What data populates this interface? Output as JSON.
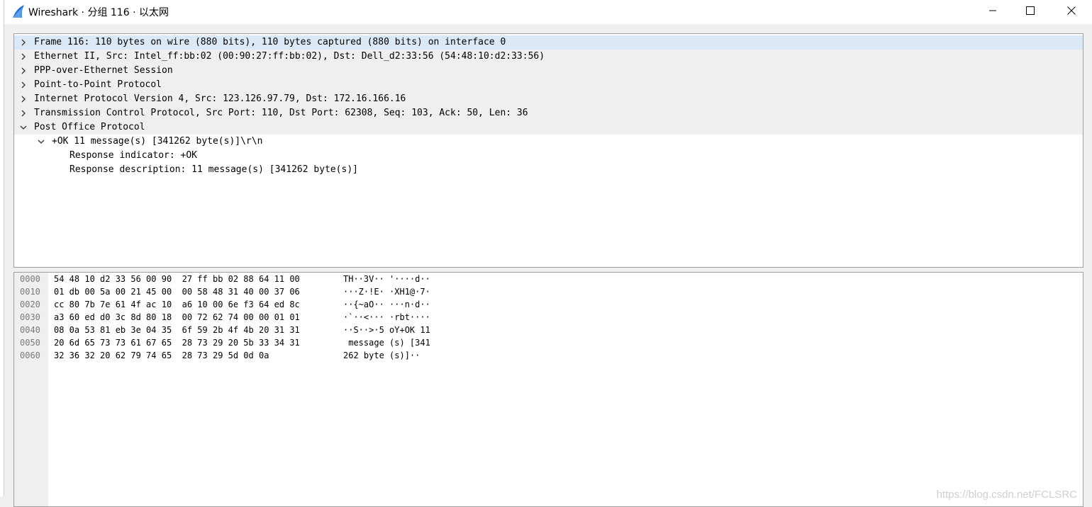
{
  "window": {
    "title": "Wireshark · 分组 116 · 以太网",
    "controls": [
      "minimize-icon",
      "maximize-icon",
      "close-icon"
    ]
  },
  "packet_tree": [
    {
      "label": "Frame 116: 110 bytes on wire (880 bits), 110 bytes captured (880 bits) on interface 0",
      "expanded": false,
      "level": 0,
      "selected": true
    },
    {
      "label": "Ethernet II, Src: Intel_ff:bb:02 (00:90:27:ff:bb:02), Dst: Dell_d2:33:56 (54:48:10:d2:33:56)",
      "expanded": false,
      "level": 0
    },
    {
      "label": "PPP-over-Ethernet Session",
      "expanded": false,
      "level": 0
    },
    {
      "label": "Point-to-Point Protocol",
      "expanded": false,
      "level": 0
    },
    {
      "label": "Internet Protocol Version 4, Src: 123.126.97.79, Dst: 172.16.166.16",
      "expanded": false,
      "level": 0
    },
    {
      "label": "Transmission Control Protocol, Src Port: 110, Dst Port: 62308, Seq: 103, Ack: 50, Len: 36",
      "expanded": false,
      "level": 0
    },
    {
      "label": "Post Office Protocol",
      "expanded": true,
      "level": 0
    },
    {
      "label": "+OK 11 message(s) [341262 byte(s)]\\r\\n",
      "expanded": true,
      "level": 1
    },
    {
      "label": "Response indicator: +OK",
      "level": 2
    },
    {
      "label": "Response description: 11 message(s) [341262 byte(s)]",
      "level": 2
    }
  ],
  "hex_dump": [
    {
      "offset": "0000",
      "bytes": "54 48 10 d2 33 56 00 90  27 ff bb 02 88 64 11 00",
      "ascii": "TH··3V·· '····d··"
    },
    {
      "offset": "0010",
      "bytes": "01 db 00 5a 00 21 45 00  00 58 48 31 40 00 37 06",
      "ascii": "···Z·!E· ·XH1@·7·"
    },
    {
      "offset": "0020",
      "bytes": "cc 80 7b 7e 61 4f ac 10  a6 10 00 6e f3 64 ed 8c",
      "ascii": "··{~aO·· ···n·d··"
    },
    {
      "offset": "0030",
      "bytes": "a3 60 ed d0 3c 8d 80 18  00 72 62 74 00 00 01 01",
      "ascii": "·`··<··· ·rbt····"
    },
    {
      "offset": "0040",
      "bytes": "08 0a 53 81 eb 3e 04 35  6f 59 2b 4f 4b 20 31 31",
      "ascii": "··S··>·5 oY+OK 11"
    },
    {
      "offset": "0050",
      "bytes": "20 6d 65 73 73 61 67 65  28 73 29 20 5b 33 34 31",
      "ascii": " message (s) [341"
    },
    {
      "offset": "0060",
      "bytes": "32 36 32 20 62 79 74 65  28 73 29 5d 0d 0a",
      "ascii": "262 byte (s)]··"
    }
  ],
  "watermark": "https://blog.csdn.net/FCLSRC",
  "colors": {
    "selected_row": "#dbe8f5",
    "top_level_row": "#efefef",
    "offset_column": "#efefef",
    "wireshark_blue": "#1e6fd1"
  }
}
